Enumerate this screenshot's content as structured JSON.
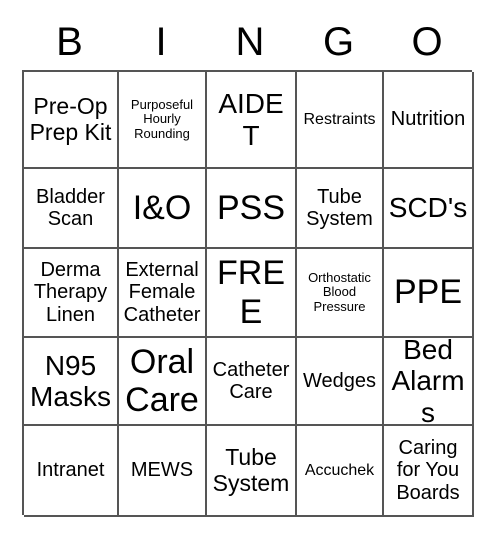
{
  "card": {
    "title": "BINGO",
    "header_letters": [
      "B",
      "I",
      "N",
      "G",
      "O"
    ],
    "rows": [
      [
        {
          "label": "Pre-Op Prep Kit",
          "size": "lg"
        },
        {
          "label": "Purposeful Hourly Rounding",
          "size": "xs"
        },
        {
          "label": "AIDET",
          "size": "xl"
        },
        {
          "label": "Restraints",
          "size": "sm"
        },
        {
          "label": "Nutrition",
          "size": "md"
        }
      ],
      [
        {
          "label": "Bladder Scan",
          "size": "md"
        },
        {
          "label": "I&O",
          "size": "xxl"
        },
        {
          "label": "PSS",
          "size": "xxl"
        },
        {
          "label": "Tube System",
          "size": "md"
        },
        {
          "label": "SCD's",
          "size": "xl"
        }
      ],
      [
        {
          "label": "Derma Therapy Linen",
          "size": "md"
        },
        {
          "label": "External Female Catheter",
          "size": "md"
        },
        {
          "label": "FREE",
          "size": "xxl"
        },
        {
          "label": "Orthostatic Blood Pressure",
          "size": "xs"
        },
        {
          "label": "PPE",
          "size": "xxl"
        }
      ],
      [
        {
          "label": "N95 Masks",
          "size": "xl"
        },
        {
          "label": "Oral Care",
          "size": "xxl"
        },
        {
          "label": "Catheter Care",
          "size": "md"
        },
        {
          "label": "Wedges",
          "size": "md"
        },
        {
          "label": "Bed Alarms",
          "size": "xl"
        }
      ],
      [
        {
          "label": "Intranet",
          "size": "md"
        },
        {
          "label": "MEWS",
          "size": "md"
        },
        {
          "label": "Tube System",
          "size": "lg"
        },
        {
          "label": "Accuchek",
          "size": "sm"
        },
        {
          "label": "Caring for You Boards",
          "size": "md"
        }
      ]
    ],
    "free_space": "FREE",
    "colors": {
      "background": "#ffffff",
      "text": "#000000",
      "grid_line": "#555555"
    }
  }
}
